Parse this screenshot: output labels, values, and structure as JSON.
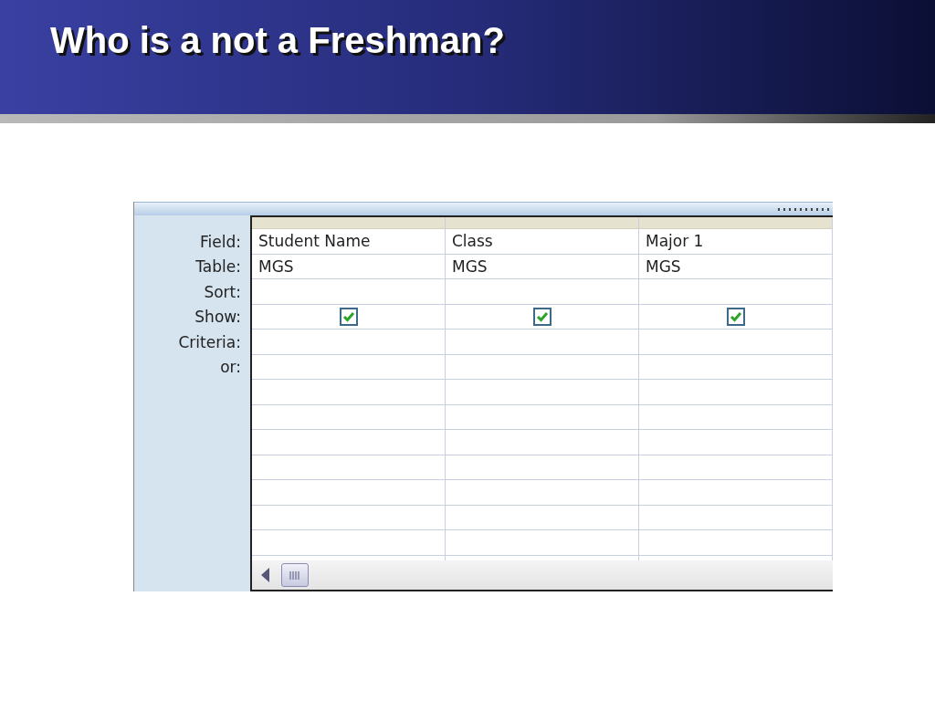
{
  "slide": {
    "title": "Who is a not a Freshman?"
  },
  "query_grid": {
    "row_labels": [
      "Field:",
      "Table:",
      "Sort:",
      "Show:",
      "Criteria:",
      "or:"
    ],
    "columns": [
      {
        "field": "Student Name",
        "table": "MGS",
        "show": true
      },
      {
        "field": "Class",
        "table": "MGS",
        "show": true
      },
      {
        "field": "Major 1",
        "table": "MGS",
        "show": true
      }
    ]
  }
}
